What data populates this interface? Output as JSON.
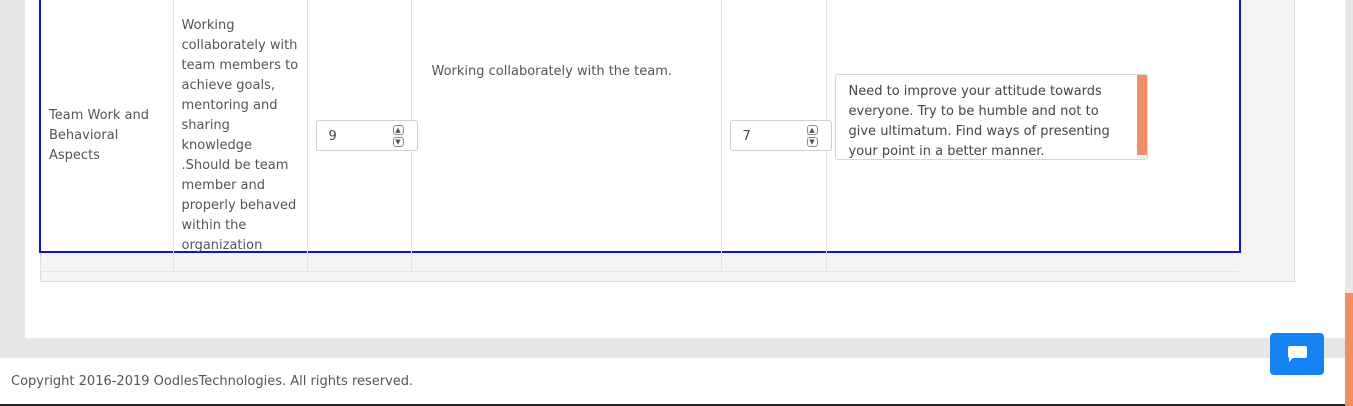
{
  "kpi_row": {
    "criteria": "Team Work and Behavioral Aspects",
    "description": "Working collaborately with team members to achieve goals, mentoring and sharing knowledge .Should be team member and properly behaved within the organization",
    "self_rating": "9",
    "self_comment": "Working collaborately with the team.",
    "manager_rating": "7",
    "manager_feedback": "Need to improve your attitude towards everyone. Try to be humble and not to give ultimatum. Find ways of presenting your point in a better manner."
  },
  "footer": {
    "copyright": "Copyright 2016-2019 OodlesTechnologies. All rights reserved."
  },
  "icons": {
    "stepper_up": "chevron-up-icon",
    "stepper_down": "chevron-down-icon",
    "chat": "chat-icon"
  },
  "colors": {
    "table_border": "#1212d6",
    "chat_button": "#1683f5",
    "accent_scroll": "#ef8f68"
  }
}
